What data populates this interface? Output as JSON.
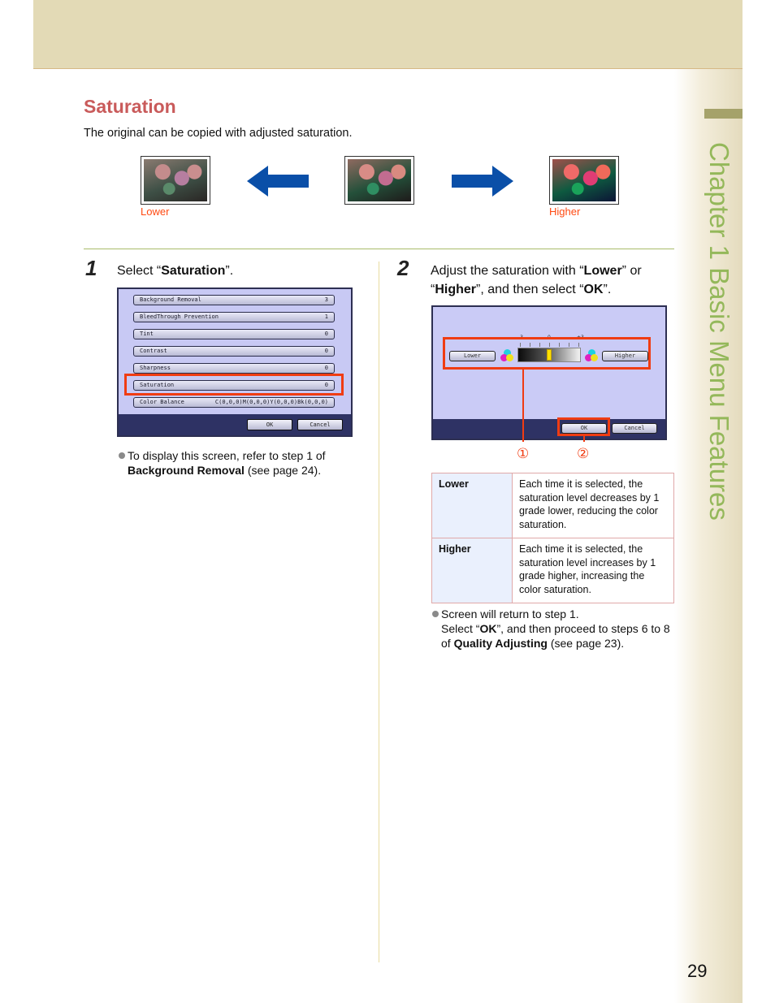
{
  "page": {
    "chapter_label": "Chapter 1   Basic Menu Features",
    "page_number": "29",
    "colors": {
      "title": "#c95b5b",
      "accent_red": "#f03c12",
      "chapter_green": "#94b85a",
      "arrow_blue": "#0a4fa8",
      "label_orange": "#ff4a12"
    }
  },
  "section": {
    "title": "Saturation",
    "intro": "The original can be copied with adjusted saturation."
  },
  "thumbnails": {
    "lower_label": "Lower",
    "higher_label": "Higher",
    "left_arrow_icon": "arrow-left-icon",
    "right_arrow_icon": "arrow-right-icon"
  },
  "step1": {
    "number": "1",
    "text_prefix": "Select “",
    "text_bold": "Saturation",
    "text_suffix": "”.",
    "screen": {
      "rows": [
        {
          "label": "Background Removal",
          "value": "3"
        },
        {
          "label": "BleedThrough Prevention",
          "value": "1"
        },
        {
          "label": "Tint",
          "value": "0"
        },
        {
          "label": "Contrast",
          "value": "0"
        },
        {
          "label": "Sharpness",
          "value": "0"
        },
        {
          "label": "Saturation",
          "value": "0"
        },
        {
          "label": "Color Balance",
          "value": "C(0,0,0)M(0,0,0)Y(0,0,0)Bk(0,0,0)"
        }
      ],
      "ok_label": "OK",
      "cancel_label": "Cancel"
    },
    "note": {
      "line1": "To display this screen, refer to step 1 of",
      "bold": "Background Removal",
      "suffix": " (see page 24)."
    }
  },
  "step2": {
    "number": "2",
    "t1": "Adjust the saturation with “",
    "b1": "Lower",
    "t2": "” or “",
    "b2": "Higher",
    "t3": "”, and then select “",
    "b3": "OK",
    "t4": "”.",
    "screen": {
      "lower_label": "Lower",
      "higher_label": "Higher",
      "ok_label": "OK",
      "cancel_label": "Cancel",
      "tick_labels": [
        "-3",
        "0",
        "+3"
      ],
      "saturation_level": 0,
      "level_range": [
        -3,
        3
      ]
    },
    "callouts": [
      "①",
      "②"
    ],
    "table": [
      {
        "key": "Lower",
        "value": "Each time it is selected, the saturation level decreases by 1 grade lower, reducing the color saturation."
      },
      {
        "key": "Higher",
        "value": "Each time it is selected, the saturation level increases by 1 grade higher, increasing the color saturation."
      }
    ],
    "note": {
      "line1": "Screen will return to step 1.",
      "l2_prefix": "Select “",
      "l2_bold": "OK",
      "l2_suffix": "”, and then proceed to steps 6 to 8 of ",
      "l2_bold2": "Quality Adjusting",
      "l2_end": " (see page 23)."
    }
  }
}
